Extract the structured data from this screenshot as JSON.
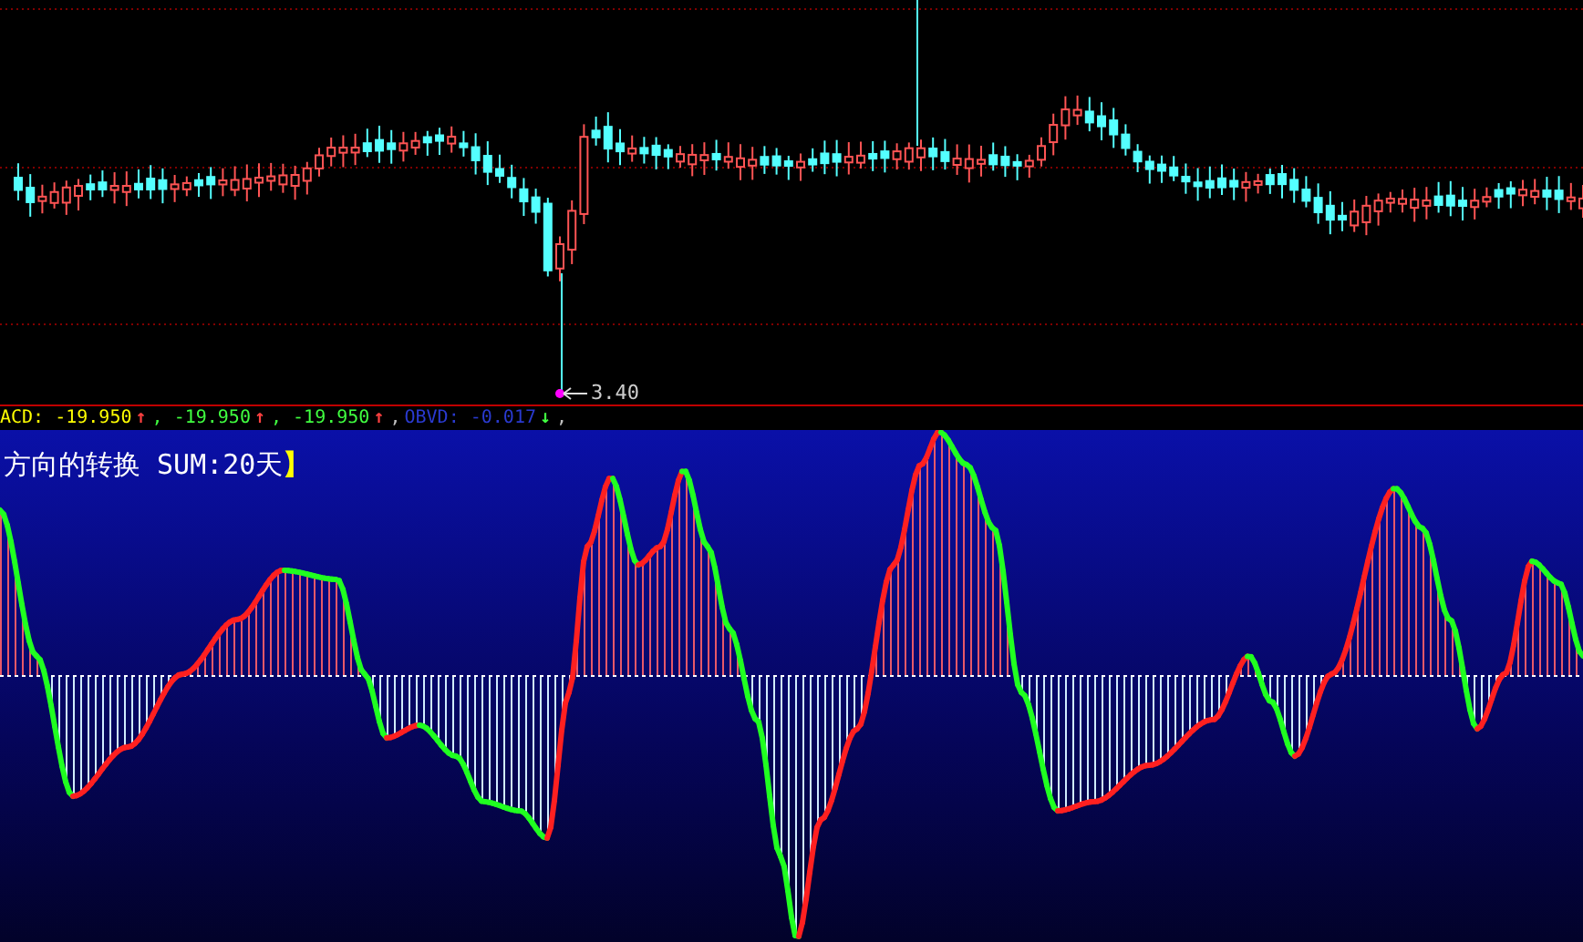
{
  "price_panel": {
    "low_marker": "3.40"
  },
  "indicator_header": [
    {
      "kind": "text",
      "text": "ACD: -19.950",
      "color": "#ffff00"
    },
    {
      "kind": "arrow",
      "text": "↑",
      "color": "#ff4040"
    },
    {
      "kind": "text",
      "text": ", -19.950",
      "color": "#40ff40"
    },
    {
      "kind": "arrow",
      "text": "↑",
      "color": "#ff4040"
    },
    {
      "kind": "text",
      "text": ", -19.950",
      "color": "#40ff40"
    },
    {
      "kind": "arrow",
      "text": "↑",
      "color": "#ff4040"
    },
    {
      "kind": "text",
      "text": ",",
      "color": "#c0c0c0"
    },
    {
      "kind": "text",
      "text": "OBVD: -0.017",
      "color": "#2a3ad0"
    },
    {
      "kind": "arrow",
      "text": "↓",
      "color": "#40ff40"
    },
    {
      "kind": "text",
      "text": ",",
      "color": "#c0c0c0"
    }
  ],
  "indicator_panel": {
    "title": "方向的转换 SUM:20天",
    "title_mark": "】"
  }
}
